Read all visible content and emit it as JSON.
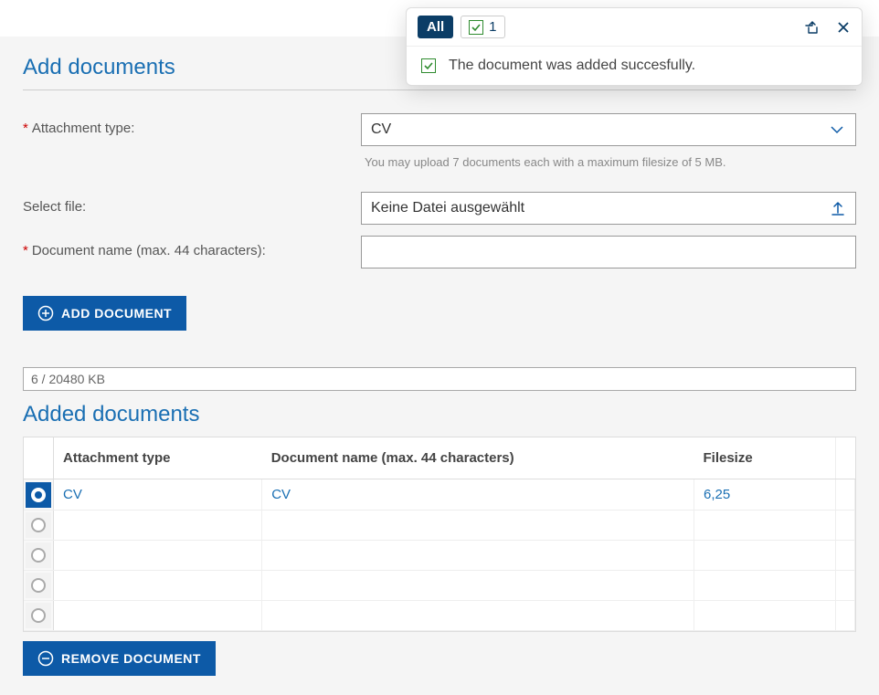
{
  "notification": {
    "all_label": "All",
    "count": "1",
    "message": "The document was added succesfully."
  },
  "add_section": {
    "title": "Add documents",
    "attachment_type_label": "Attachment type:",
    "attachment_type_value": "CV",
    "upload_hint": "You may upload 7  documents each with a maximum filesize of 5  MB.",
    "select_file_label": "Select file:",
    "select_file_value": "Keine Datei ausgewählt",
    "doc_name_label": "Document name (max. 44 characters):",
    "doc_name_value": "",
    "add_button": "ADD DOCUMENT"
  },
  "quota": "6 / 20480 KB",
  "added_section": {
    "title": "Added documents",
    "columns": {
      "attachment_type": "Attachment type",
      "document_name": "Document name (max. 44 characters)",
      "filesize": "Filesize"
    },
    "rows": [
      {
        "selected": true,
        "attachment_type": "CV",
        "document_name": "CV",
        "filesize": "6,25"
      },
      {
        "selected": false,
        "attachment_type": "",
        "document_name": "",
        "filesize": ""
      },
      {
        "selected": false,
        "attachment_type": "",
        "document_name": "",
        "filesize": ""
      },
      {
        "selected": false,
        "attachment_type": "",
        "document_name": "",
        "filesize": ""
      },
      {
        "selected": false,
        "attachment_type": "",
        "document_name": "",
        "filesize": ""
      }
    ],
    "remove_button": "REMOVE DOCUMENT"
  }
}
